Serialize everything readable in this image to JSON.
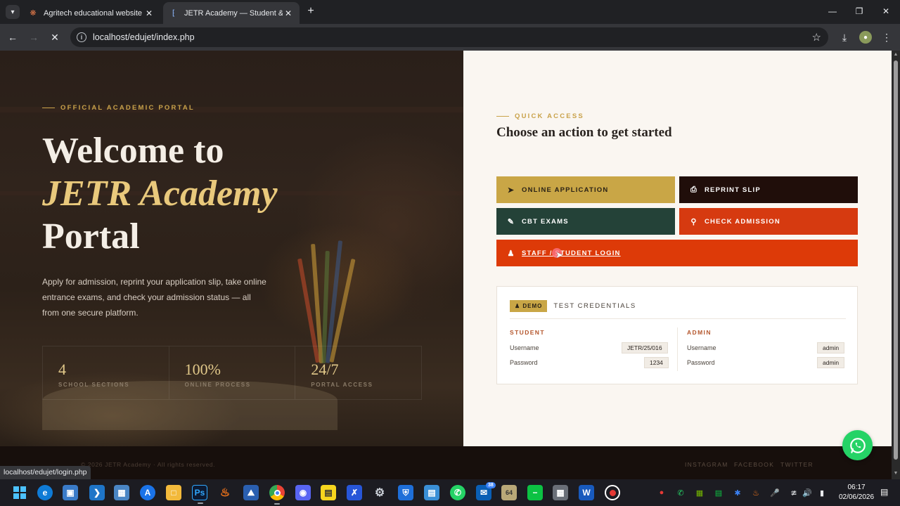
{
  "browser": {
    "tabs": [
      {
        "title": "Agritech educational website re",
        "active": false,
        "favicon": "agritech-favicon"
      },
      {
        "title": "JETR Academy — Student & Ad",
        "active": true,
        "favicon": "loading-spinner-icon"
      }
    ],
    "url": "localhost/edujet/index.php",
    "status_url": "localhost/edujet/login.php"
  },
  "hero": {
    "eyebrow": "OFFICIAL ACADEMIC PORTAL",
    "title_line1": "Welcome to",
    "title_accent": "JETR Academy",
    "title_line3": "Portal",
    "description": "Apply for admission, reprint your application slip, take online entrance exams, and check your admission status — all from one secure platform.",
    "stats": [
      {
        "value": "4",
        "label": "SCHOOL SECTIONS"
      },
      {
        "value": "100%",
        "label": "ONLINE PROCESS"
      },
      {
        "value": "24/7",
        "label": "PORTAL ACCESS"
      }
    ]
  },
  "panel": {
    "eyebrow": "QUICK ACCESS",
    "title": "Choose an action to get started",
    "buttons": {
      "online_application": "ONLINE APPLICATION",
      "reprint_slip": "REPRINT SLIP",
      "cbt_exams": "CBT EXAMS",
      "check_admission": "CHECK ADMISSION",
      "login": "STAFF / STUDENT LOGIN"
    },
    "credentials": {
      "badge": "DEMO",
      "heading": "TEST CREDENTIALS",
      "student": {
        "heading": "STUDENT",
        "username_label": "Username",
        "username": "JETR/25/016",
        "password_label": "Password",
        "password": "1234"
      },
      "admin": {
        "heading": "ADMIN",
        "username_label": "Username",
        "username": "admin",
        "password_label": "Password",
        "password": "admin"
      }
    }
  },
  "footer": {
    "copyright": "© 2026 JETR Academy · All rights reserved.",
    "social": [
      "INSTAGRAM",
      "FACEBOOK",
      "TWITTER"
    ]
  },
  "taskbar": {
    "time": "06:17",
    "date": "02/06/2026",
    "mail_badge": "38"
  },
  "colors": {
    "gold": "#c9a646",
    "dark_maroon": "#200e0a",
    "forest_green": "#244238",
    "orange_red": "#d63a10",
    "cream": "#faf6f1"
  }
}
